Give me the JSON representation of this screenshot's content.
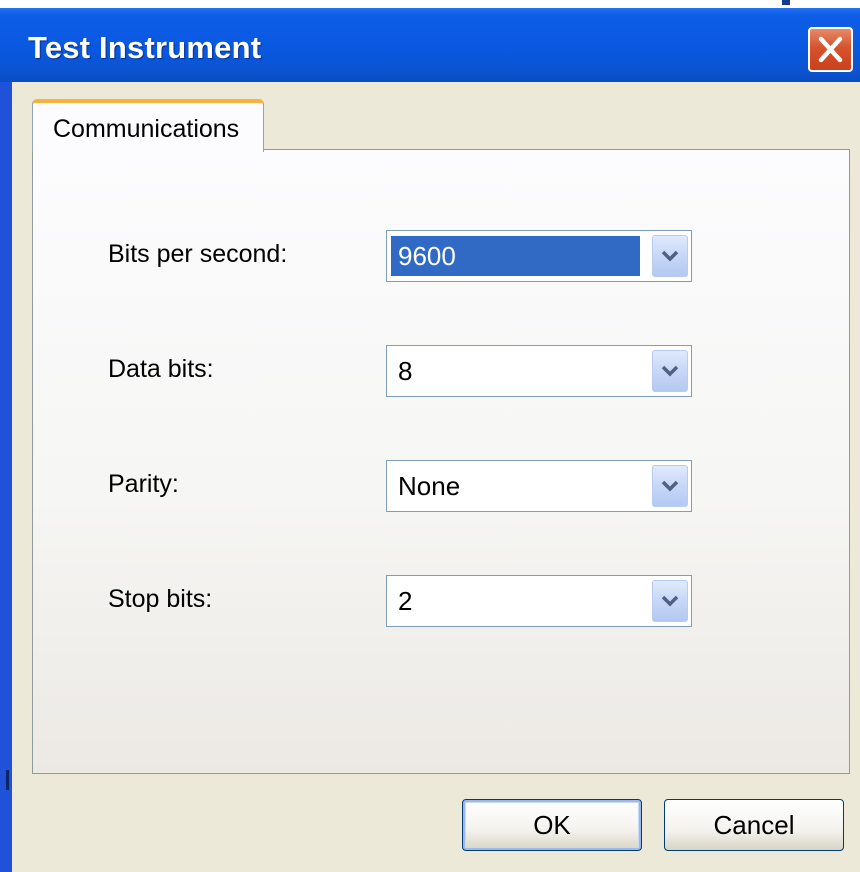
{
  "window": {
    "title": "Test Instrument",
    "close_icon": "close-icon"
  },
  "tabs": [
    {
      "label": "Communications",
      "active": true
    }
  ],
  "fields": {
    "bits_per_second": {
      "label": "Bits per second:",
      "value": "9600",
      "selected": true
    },
    "data_bits": {
      "label": "Data bits:",
      "value": "8"
    },
    "parity": {
      "label": "Parity:",
      "value": "None"
    },
    "stop_bits": {
      "label": "Stop bits:",
      "value": "2"
    }
  },
  "buttons": {
    "ok": "OK",
    "cancel": "Cancel"
  },
  "colors": {
    "titlebar": "#0a58e0",
    "dialog_background": "#ece9d8",
    "selection_highlight": "#316ac5",
    "tab_accent": "#f6b23c",
    "close_button": "#d7532e"
  }
}
